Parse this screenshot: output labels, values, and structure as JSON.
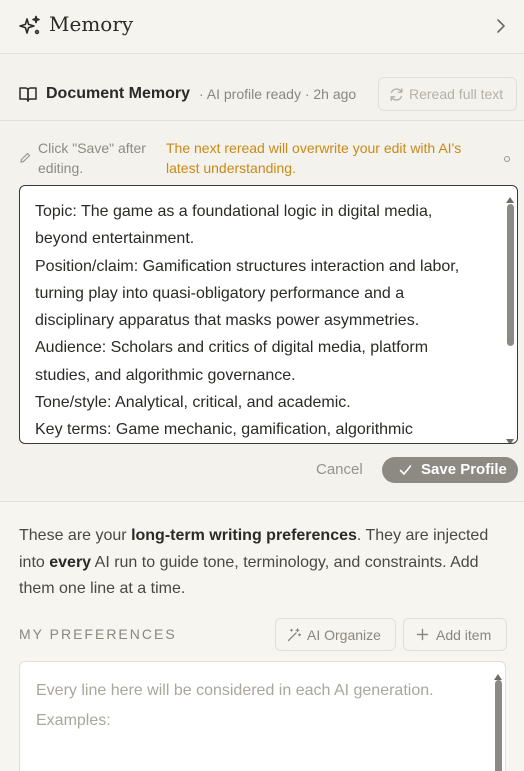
{
  "header": {
    "title": "Memory",
    "icon": "sparkle-icon",
    "expand_icon": "chevron-right-icon"
  },
  "document_memory": {
    "title": "Document Memory",
    "status": "· AI profile ready · 2h ago",
    "reread_button": "Reread full text",
    "hint": "Click \"Save\" after editing.",
    "warning": "The next reread will overwrite your edit with AI's latest understanding.",
    "warning_color": "#c88a16",
    "profile_lines": [
      "Topic: The game as a foundational logic in digital media,",
      "beyond entertainment.",
      "Position/claim: Gamification structures interaction and labor,",
      "turning play into quasi-obligatory performance and a",
      "disciplinary apparatus that masks power asymmetries.",
      "Audience: Scholars and critics of digital media, platform",
      "studies, and algorithmic governance.",
      "Tone/style: Analytical, critical, and academic.",
      "Key terms: Game mechanic, gamification, algorithmic"
    ],
    "cancel_button": "Cancel",
    "save_button": "Save Profile"
  },
  "preferences": {
    "intro_1": "These are your ",
    "intro_bold_1": "long-term writing preferences",
    "intro_2": ". They are injected into ",
    "intro_bold_2": "every",
    "intro_3": " AI run to guide tone, terminology, and constraints. Add them one line at a time.",
    "section_label": "MY PREFERENCES",
    "organize_button": "AI Organize",
    "add_button": "Add item",
    "placeholder_line_1": "Every line here will be considered in each AI generation.",
    "placeholder_line_2": "Examples:"
  }
}
